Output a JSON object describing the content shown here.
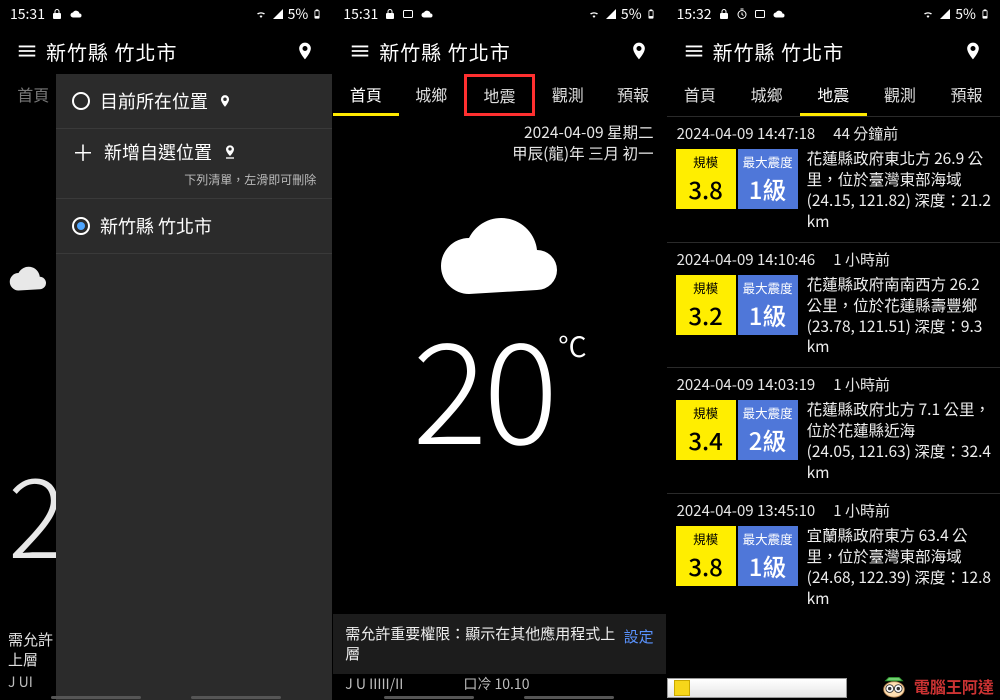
{
  "statusbar": {
    "p1_time": "15:31",
    "p2_time": "15:31",
    "p3_time": "15:32",
    "battery": "5%"
  },
  "common": {
    "location": "新竹縣 竹北市",
    "tabs": [
      "首頁",
      "城鄉",
      "地震",
      "觀測",
      "預報"
    ]
  },
  "p1": {
    "sheet": {
      "current_loc": "目前所在位置",
      "add_loc": "新增自選位置",
      "hint": "下列清單，左滑即可刪除",
      "selected": "新竹縣 竹北市"
    },
    "bg_temp_peek": "2",
    "perm_peek_l1": "需允許",
    "perm_peek_l2": "上層",
    "faint_peek": "J  UI"
  },
  "p2": {
    "date_l1": "2024-04-09 星期二",
    "date_l2": "甲辰(龍)年 三月 初一",
    "temp_value": "20",
    "temp_unit": "°C",
    "perm_text": "需允許重要權限：顯示在其他應用程式上層",
    "perm_action": "設定",
    "faint_l": "J  U IIIII/II",
    "faint_r": "口冷 10.10"
  },
  "p3": {
    "tile_mag_label": "規模",
    "tile_int_label": "最大震度",
    "items": [
      {
        "time": "2024-04-09 14:47:18",
        "ago": "44 分鐘前",
        "mag": "3.8",
        "int": "1級",
        "desc": "花蓮縣政府東北方 26.9 公里，位於臺灣東部海域\n(24.15, 121.82) 深度：21.2 km"
      },
      {
        "time": "2024-04-09 14:10:46",
        "ago": "1 小時前",
        "mag": "3.2",
        "int": "1級",
        "desc": "花蓮縣政府南南西方 26.2 公里，位於花蓮縣壽豐鄉\n(23.78, 121.51) 深度：9.3 km"
      },
      {
        "time": "2024-04-09 14:03:19",
        "ago": "1 小時前",
        "mag": "3.4",
        "int": "2級",
        "desc": "花蓮縣政府北方 7.1 公里，位於花蓮縣近海\n(24.05, 121.63) 深度：32.4 km"
      },
      {
        "time": "2024-04-09 13:45:10",
        "ago": "1 小時前",
        "mag": "3.8",
        "int": "1級",
        "desc": "宜蘭縣政府東方 63.4 公里，位於臺灣東部海域\n(24.68, 122.39) 深度：12.8 km"
      }
    ]
  },
  "watermark": "電腦王阿達"
}
